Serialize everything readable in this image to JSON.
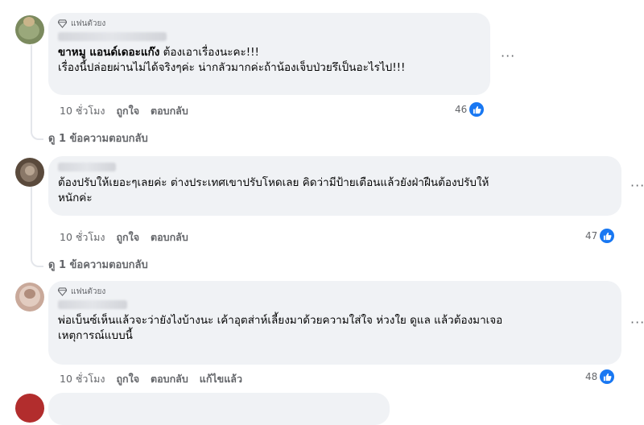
{
  "comments": [
    {
      "badge": "แฟนตัวยง",
      "author": "ขาหมู แอนด์เดอะแก๊ง",
      "line1": "ต้องเอาเรื่องนะคะ!!!",
      "line2": "เรื่องนี้ปล่อยผ่านไม่ได้จริงๆค่ะ น่ากลัวมากค่ะถ้าน้องเจ็บป่วยรึเป็นอะไรไป!!!",
      "time": "10 ชั่วโมง",
      "like": "ถูกใจ",
      "reply": "ตอบกลับ",
      "reaction_count": "46",
      "more": "···",
      "view_replies": "ดู 1 ข้อความตอบกลับ"
    },
    {
      "line1": "ต้องปรับให้เยอะๆเลยค่ะ ต่างประเทศเขาปรับโหดเลย คิดว่ามีป้ายเตือนแล้วยังฝ่าฝืนต้องปรับให้",
      "line2": "หนักค่ะ",
      "time": "10 ชั่วโมง",
      "like": "ถูกใจ",
      "reply": "ตอบกลับ",
      "reaction_count": "47",
      "more": "···",
      "view_replies": "ดู 1 ข้อความตอบกลับ"
    },
    {
      "badge": "แฟนตัวยง",
      "line1": "พ่อเบ็นซ์เห็นแล้วจะว่ายังไงบ้างนะ เค้าอุตส่าห์เลี้ยงมาด้วยความใส่ใจ ห่วงใย ดูแล แล้วต้องมาเจอ",
      "line2": "เหตุการณ์แบบนี้",
      "time": "10 ชั่วโมง",
      "like": "ถูกใจ",
      "reply": "ตอบกลับ",
      "edited": "แก้ไขแล้ว",
      "reaction_count": "48",
      "more": "···"
    }
  ],
  "icons": {
    "badge": "diamond-icon",
    "reaction": "thumbs-up-icon"
  },
  "colors": {
    "bubble": "#f0f2f5",
    "like_blue": "#1877f2",
    "secondary_text": "#65676b"
  }
}
